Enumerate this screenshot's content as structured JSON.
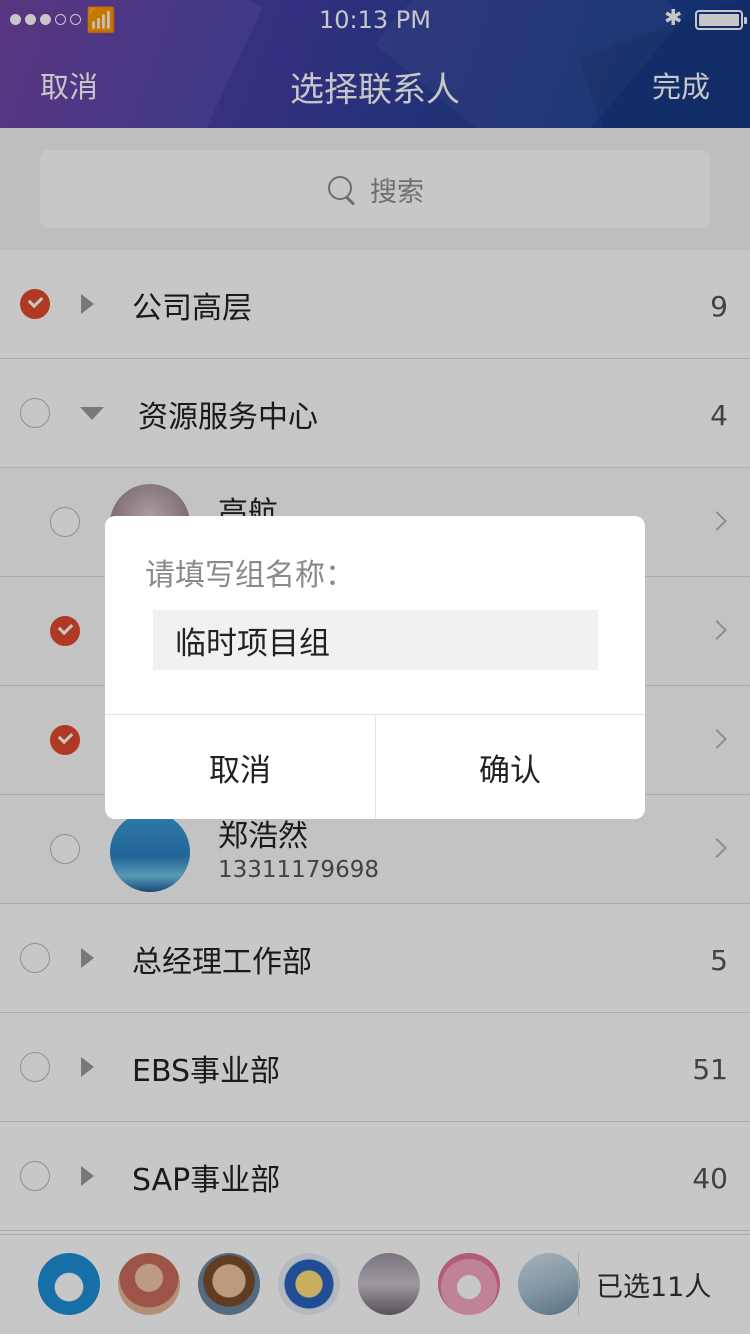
{
  "status_bar": {
    "time": "10:13 PM"
  },
  "nav": {
    "cancel": "取消",
    "title": "选择联系人",
    "done": "完成"
  },
  "search": {
    "placeholder": "搜索"
  },
  "groups": [
    {
      "name": "公司高层",
      "count": "9",
      "checked": true,
      "expanded": false
    },
    {
      "name": "资源服务中心",
      "count": "4",
      "checked": false,
      "expanded": true
    },
    {
      "name": "总经理工作部",
      "count": "5",
      "checked": false,
      "expanded": false
    },
    {
      "name": "EBS事业部",
      "count": "51",
      "checked": false,
      "expanded": false
    },
    {
      "name": "SAP事业部",
      "count": "40",
      "checked": false,
      "expanded": false
    }
  ],
  "members": [
    {
      "name": "高航",
      "phone": "",
      "checked": false
    },
    {
      "name": "",
      "phone": "",
      "checked": true
    },
    {
      "name": "",
      "phone": "",
      "checked": true
    },
    {
      "name": "郑浩然",
      "phone": "13311179698",
      "checked": false
    }
  ],
  "bottom": {
    "selected_label": "已选11人"
  },
  "dialog": {
    "title": "请填写组名称：",
    "input_value": "临时项目组",
    "cancel": "取消",
    "confirm": "确认"
  },
  "colors": {
    "accent": "#e24a2e",
    "header_start": "#6a3aa0",
    "header_end": "#173e8d"
  }
}
